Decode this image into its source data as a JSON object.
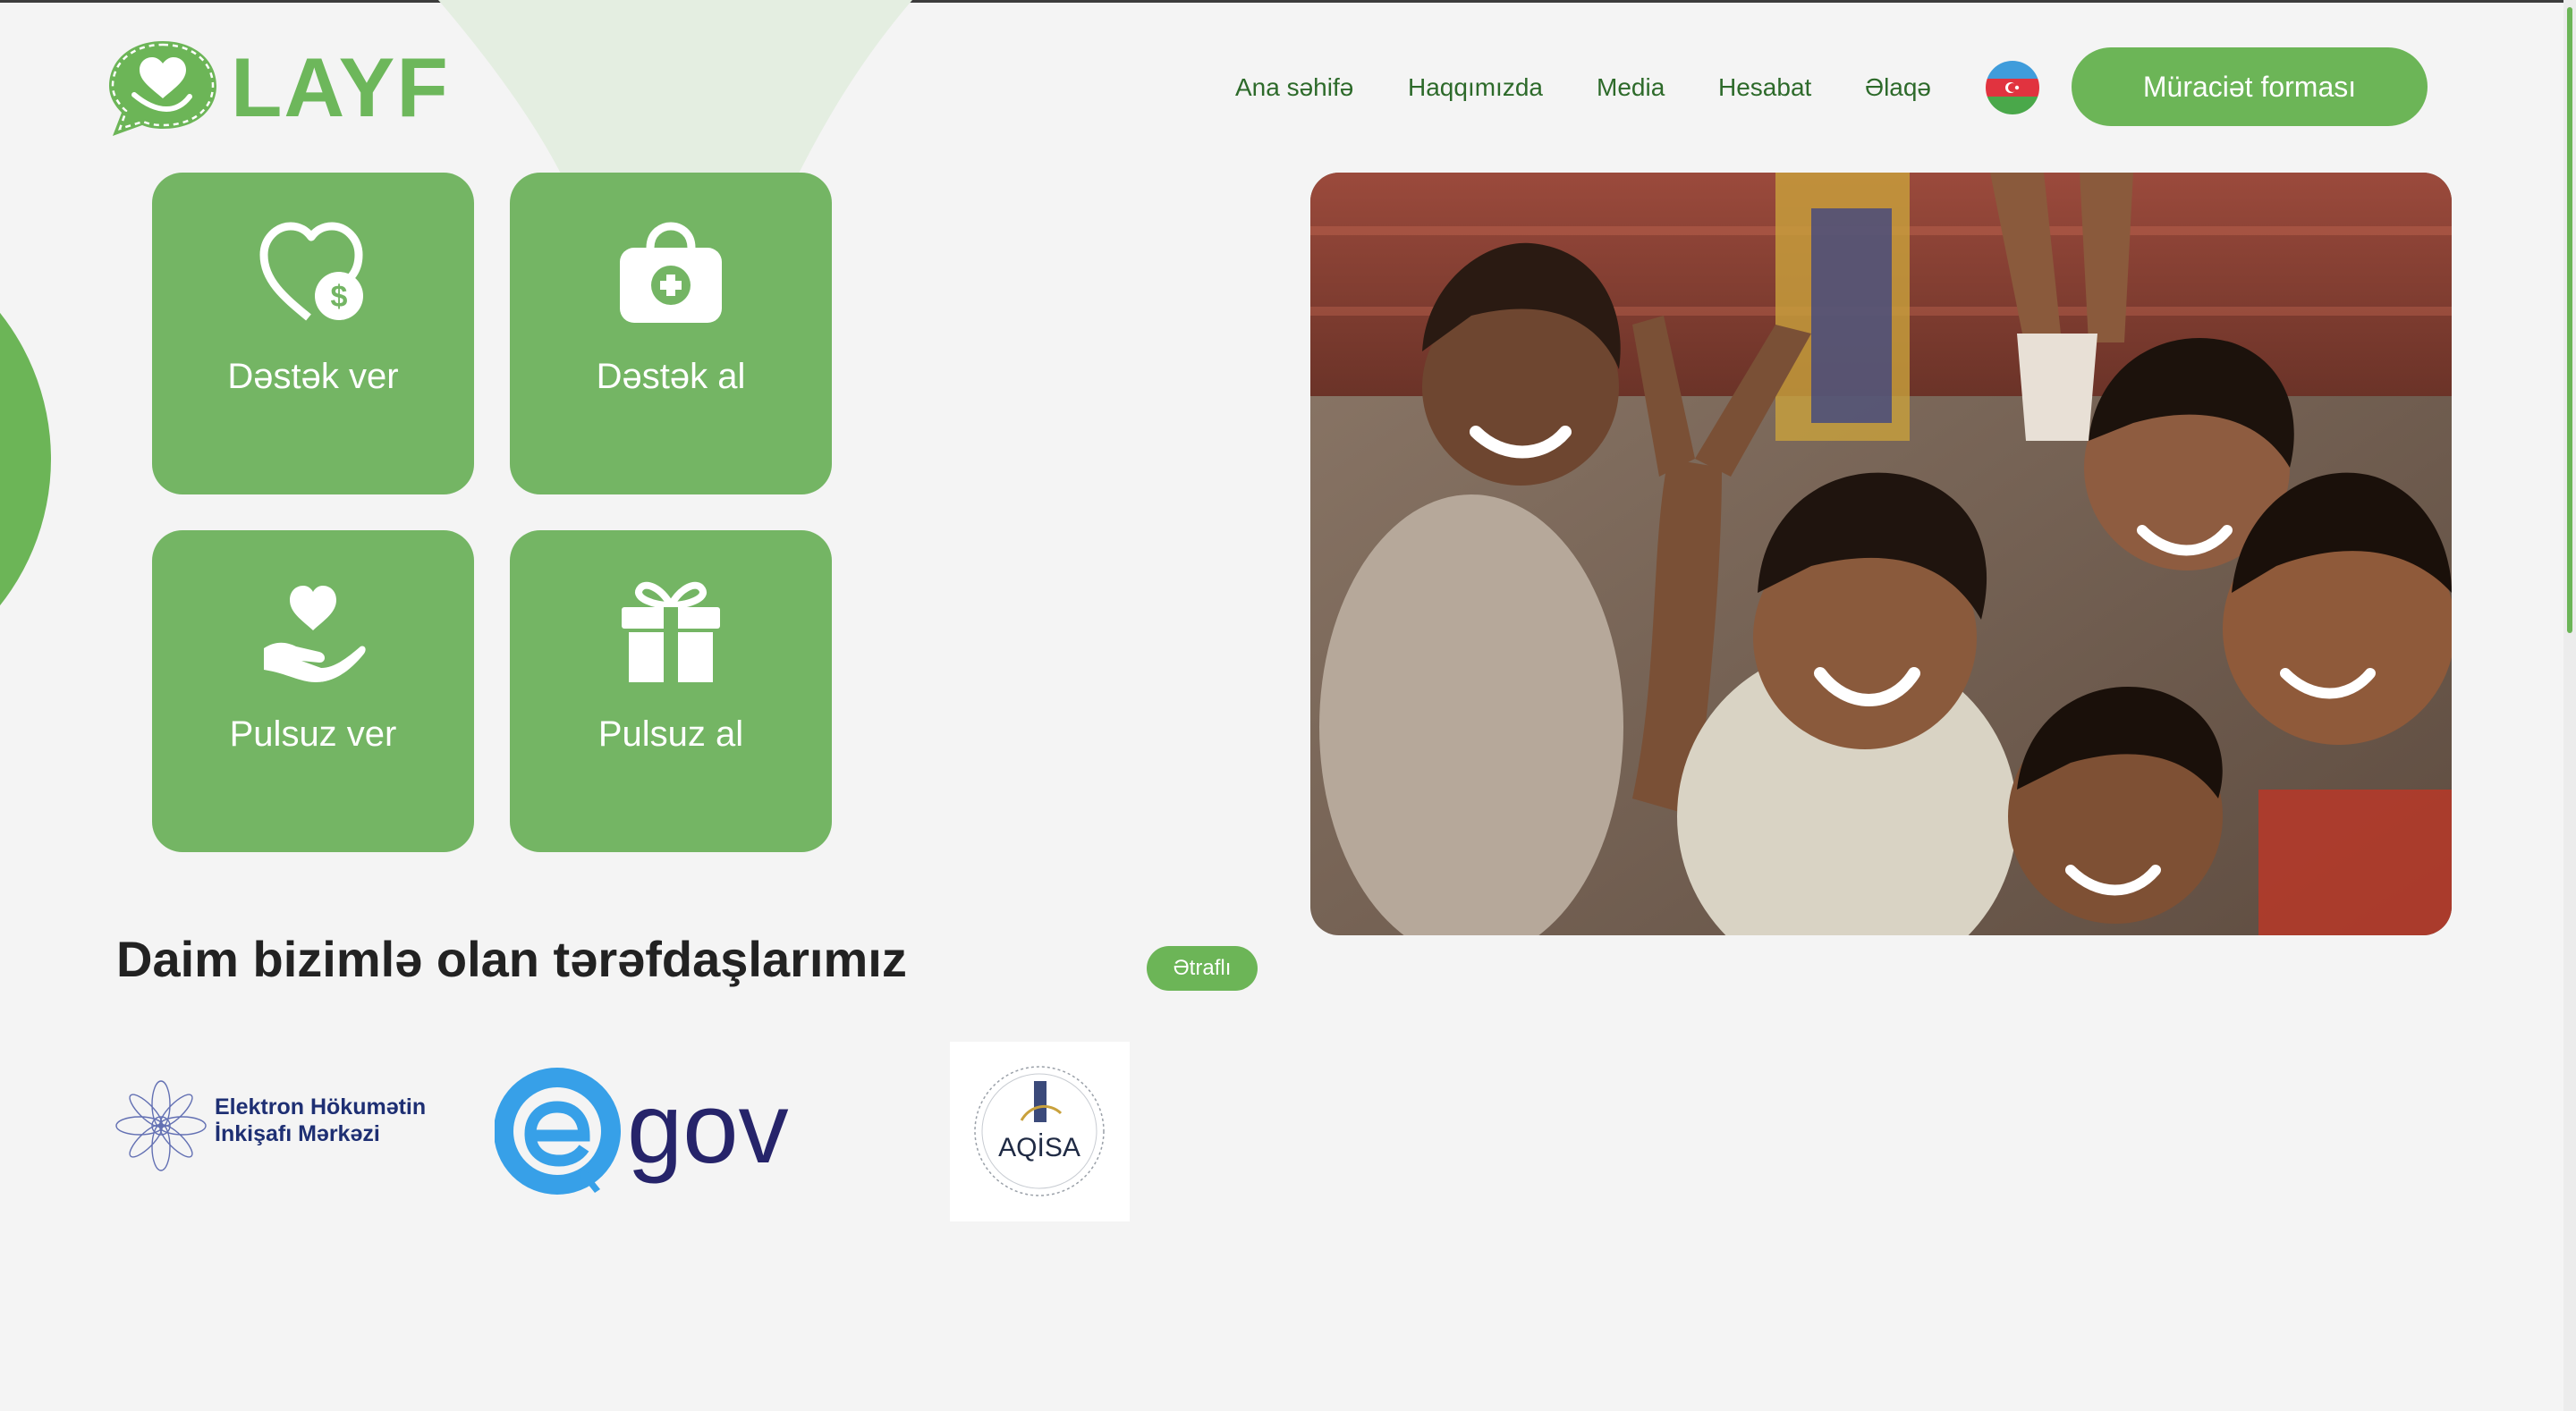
{
  "brand": {
    "name": "LAYF",
    "color": "#6cb557"
  },
  "nav": {
    "items": [
      {
        "label": "Ana səhifə"
      },
      {
        "label": "Haqqımızda"
      },
      {
        "label": "Media"
      },
      {
        "label": "Hesabat"
      },
      {
        "label": "Əlaqə"
      }
    ],
    "language_flag": "azerbaijan-flag-icon",
    "cta_label": "Müraciət forması"
  },
  "tiles": [
    {
      "label": "Dəstək ver",
      "icon": "heart-dollar-icon"
    },
    {
      "label": "Dəstək al",
      "icon": "medical-kit-icon"
    },
    {
      "label": "Pulsuz ver",
      "icon": "hand-heart-icon"
    },
    {
      "label": "Pulsuz al",
      "icon": "gift-icon"
    }
  ],
  "hero": {
    "image": "children-smiling-photo"
  },
  "partners": {
    "title": "Daim bizimlə olan tərəfdaşlarımız",
    "more_label": "Ətraflı",
    "logos": [
      {
        "name": "ehim-logo",
        "line1": "Elektron Hökumətin",
        "line2": "İnkişafı Mərkəzi"
      },
      {
        "name": "egov-logo",
        "text": "gov"
      },
      {
        "name": "aqisa-logo",
        "text": "AQİSA"
      }
    ]
  }
}
